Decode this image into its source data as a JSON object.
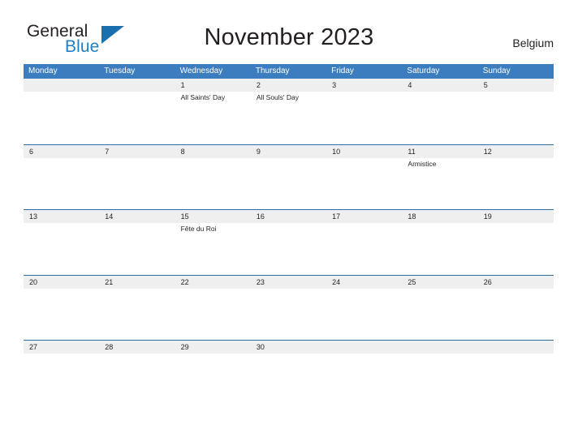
{
  "brand": {
    "name_part1": "General",
    "name_part2": "Blue"
  },
  "header": {
    "title": "November 2023",
    "country": "Belgium"
  },
  "colors": {
    "header_blue": "#3C7DBF",
    "rule_blue": "#2E6DA4",
    "strip_gray": "#EFEFEF",
    "logo_blue": "#1F7FC4",
    "text": "#231F20"
  },
  "calendar": {
    "weekday_headers": [
      "Monday",
      "Tuesday",
      "Wednesday",
      "Thursday",
      "Friday",
      "Saturday",
      "Sunday"
    ],
    "weeks": [
      {
        "days": [
          {
            "num": "",
            "events": []
          },
          {
            "num": "",
            "events": []
          },
          {
            "num": "1",
            "events": [
              "All Saints' Day"
            ]
          },
          {
            "num": "2",
            "events": [
              "All Souls' Day"
            ]
          },
          {
            "num": "3",
            "events": []
          },
          {
            "num": "4",
            "events": []
          },
          {
            "num": "5",
            "events": []
          }
        ]
      },
      {
        "days": [
          {
            "num": "6",
            "events": []
          },
          {
            "num": "7",
            "events": []
          },
          {
            "num": "8",
            "events": []
          },
          {
            "num": "9",
            "events": []
          },
          {
            "num": "10",
            "events": []
          },
          {
            "num": "11",
            "events": [
              "Armistice"
            ]
          },
          {
            "num": "12",
            "events": []
          }
        ]
      },
      {
        "days": [
          {
            "num": "13",
            "events": []
          },
          {
            "num": "14",
            "events": []
          },
          {
            "num": "15",
            "events": [
              "Fête du Roi"
            ]
          },
          {
            "num": "16",
            "events": []
          },
          {
            "num": "17",
            "events": []
          },
          {
            "num": "18",
            "events": []
          },
          {
            "num": "19",
            "events": []
          }
        ]
      },
      {
        "days": [
          {
            "num": "20",
            "events": []
          },
          {
            "num": "21",
            "events": []
          },
          {
            "num": "22",
            "events": []
          },
          {
            "num": "23",
            "events": []
          },
          {
            "num": "24",
            "events": []
          },
          {
            "num": "25",
            "events": []
          },
          {
            "num": "26",
            "events": []
          }
        ]
      },
      {
        "days": [
          {
            "num": "27",
            "events": []
          },
          {
            "num": "28",
            "events": []
          },
          {
            "num": "29",
            "events": []
          },
          {
            "num": "30",
            "events": []
          },
          {
            "num": "",
            "events": []
          },
          {
            "num": "",
            "events": []
          },
          {
            "num": "",
            "events": []
          }
        ]
      }
    ]
  }
}
